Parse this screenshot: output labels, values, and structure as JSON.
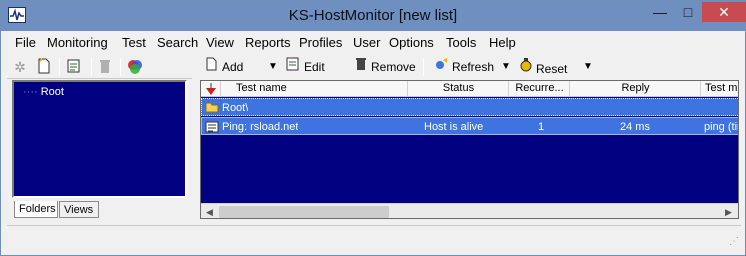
{
  "window": {
    "title": "KS-HostMonitor  [new list]",
    "buttons": {
      "minimize": "—",
      "maximize": "□",
      "close": "✕"
    }
  },
  "menu": {
    "items": [
      "File",
      "Monitoring",
      "Test",
      "Search",
      "View",
      "Reports",
      "Profiles",
      "User",
      "Options",
      "Tools",
      "Help"
    ]
  },
  "left_toolbar": {
    "icons": [
      "new-folder-icon",
      "new-file-icon",
      "properties-icon",
      "delete-icon",
      "color-icon"
    ]
  },
  "folder_tree": {
    "root_label": "Root"
  },
  "folder_tabs": [
    "Folders",
    "Views"
  ],
  "right_toolbar": {
    "add_label": "Add",
    "edit_label": "Edit",
    "remove_label": "Remove",
    "refresh_label": "Refresh",
    "reset_label": "Reset"
  },
  "list": {
    "columns": [
      "Test name",
      "Status",
      "Recurre...",
      "Reply",
      "Test m"
    ],
    "rows": [
      {
        "name": "Root\\",
        "status": "",
        "recurrence": "",
        "reply": "",
        "method": "",
        "icon": "folder-icon"
      },
      {
        "name": "Ping: rsload.net",
        "status": "Host is alive",
        "recurrence": "1",
        "reply": "24 ms",
        "method": "ping (tir",
        "icon": "ping-test-icon"
      }
    ]
  },
  "colors": {
    "pane_bg": "#000080",
    "selection": "#3f74e0",
    "titlebar": "#6e8fc0",
    "close_button": "#c74b50"
  }
}
